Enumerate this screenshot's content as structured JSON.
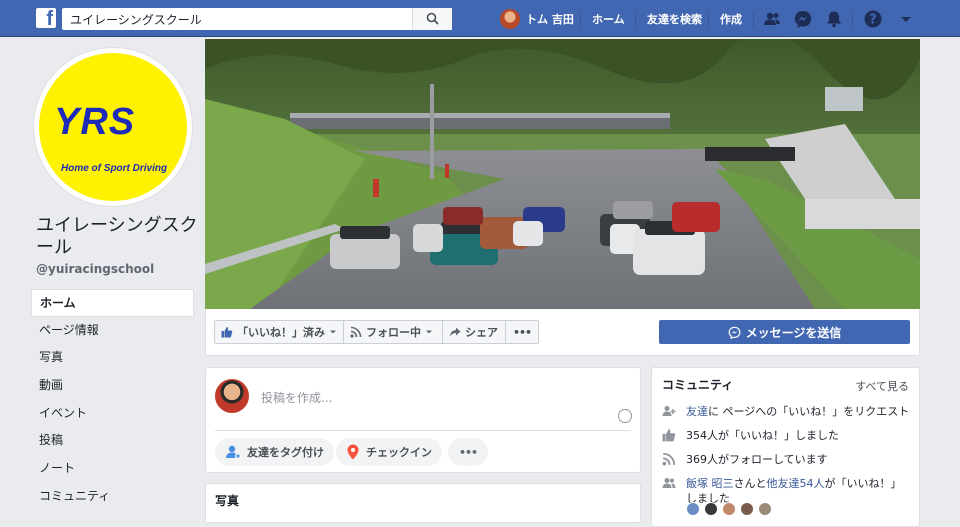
{
  "topbar": {
    "logo": "f",
    "search_value": "ユイレーシングスクール",
    "user_name": "トム 吉田",
    "home": "ホーム",
    "find_friends": "友達を検索",
    "create": "作成"
  },
  "page": {
    "logo_text": "YRS",
    "logo_subtitle": "Home of Sport Driving",
    "name": "ユイレーシングスクール",
    "handle": "@yuiracingschool"
  },
  "sidebar": {
    "items": [
      {
        "label": "ホーム"
      },
      {
        "label": "ページ情報"
      },
      {
        "label": "写真"
      },
      {
        "label": "動画"
      },
      {
        "label": "イベント"
      },
      {
        "label": "投稿"
      },
      {
        "label": "ノート"
      },
      {
        "label": "コミュニティ"
      }
    ]
  },
  "actions": {
    "liked": "「いいね！」済み",
    "following": "フォロー中",
    "share": "シェア",
    "more": "•••",
    "message": "メッセージを送信"
  },
  "composer": {
    "placeholder": "投稿を作成...",
    "tag_friends": "友達をタグ付け",
    "checkin": "チェックイン",
    "more": "•••"
  },
  "photos": {
    "title": "写真"
  },
  "community": {
    "title": "コミュニティ",
    "see_all": "すべて見る",
    "invite_link": "友達",
    "invite_rest": "に ページへの「いいね！」をリクエスト",
    "likes": "354人が「いいね！」しました",
    "follows": "369人がフォローしています",
    "friend_name": "飯塚 昭三",
    "friend_mid": "さんと",
    "friend_others": "他友達54人",
    "friend_end": "が「いいね！」しました"
  },
  "colors": {
    "brand": "#4267b2",
    "logo_yellow": "#fef200",
    "logo_blue": "#1e2bb8"
  }
}
